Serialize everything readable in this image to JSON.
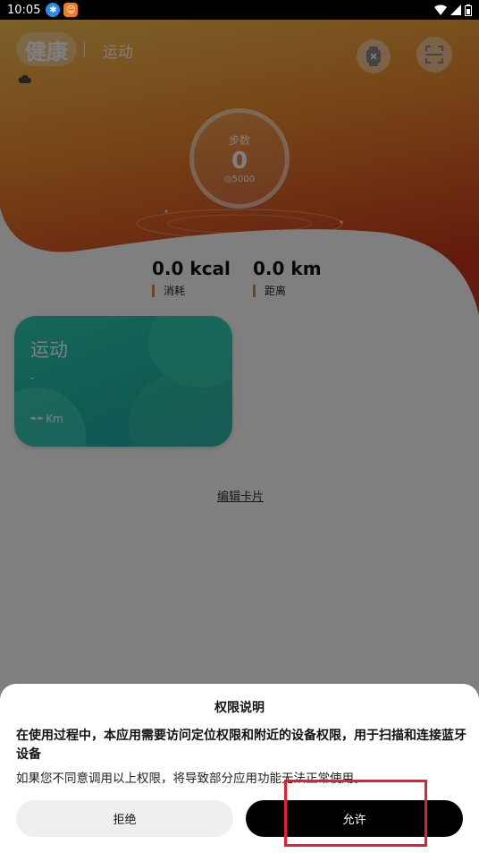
{
  "status_bar": {
    "time": "10:05",
    "app_icon_1": "bluetooth-app-icon",
    "app_icon_2": "orange-app-icon",
    "right_icons": [
      "wifi-icon",
      "signal-icon",
      "battery-icon"
    ]
  },
  "header": {
    "title": "健康",
    "tab_sport": "运动",
    "weather_icon": "cloud-icon",
    "watch_icon": "watch-disconnected-icon",
    "scan_icon": "scan-icon"
  },
  "steps": {
    "label": "步数",
    "value": "0",
    "goal_icon": "target-icon",
    "goal": "5000"
  },
  "stats": {
    "kcal_value": "0.0 kcal",
    "kcal_label": "消耗",
    "distance_value": "0.0 km",
    "distance_label": "距离"
  },
  "card": {
    "title": "运动",
    "subtitle": "-",
    "distance_value": "--",
    "distance_unit": "Km"
  },
  "edit_cards": "编辑卡片",
  "dialog": {
    "title": "权限说明",
    "bold_text": "在使用过程中，本应用需要访问定位权限和附近的设备权限，用于扫描和连接蓝牙设备",
    "description": "如果您不同意调用以上权限，将导致部分应用功能无法正常使用。",
    "deny_label": "拒绝",
    "allow_label": "允许"
  },
  "colors": {
    "hero_top": "#f6b44b",
    "hero_bottom": "#d64a1f",
    "card_accent": "#21c2ab",
    "highlight": "#e5202e"
  }
}
